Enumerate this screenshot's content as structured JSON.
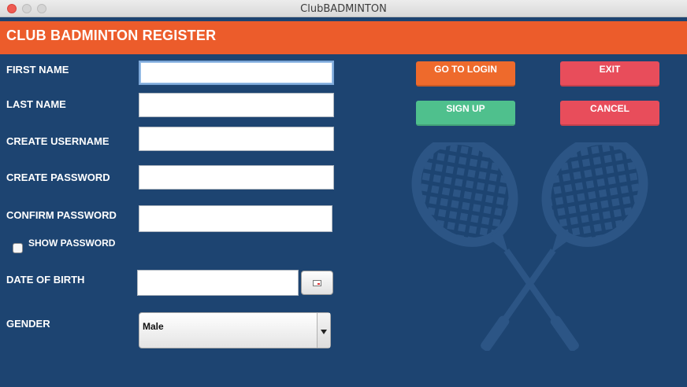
{
  "window": {
    "title": "ClubBADMINTON"
  },
  "header": {
    "title": "CLUB BADMINTON REGISTER"
  },
  "form": {
    "first_name_label": "FIRST NAME",
    "last_name_label": "LAST NAME",
    "username_label": "CREATE USERNAME",
    "password_label": "CREATE PASSWORD",
    "confirm_password_label": "CONFIRM PASSWORD",
    "show_password_label": "SHOW PASSWORD",
    "dob_label": "DATE OF BIRTH",
    "gender_label": "GENDER",
    "first_name_value": "",
    "last_name_value": "",
    "username_value": "",
    "password_value": "",
    "confirm_password_value": "",
    "dob_value": "",
    "gender_value": "Male"
  },
  "buttons": {
    "go_to_login": "GO TO LOGIN",
    "exit": "EXIT",
    "sign_up": "SIGN UP",
    "cancel": "CANCEL"
  },
  "colors": {
    "background": "#1d4471",
    "header": "#ec5c2b",
    "orange_button": "#ee6a2c",
    "red_button": "#e84d5b",
    "green_button": "#4fc08d"
  },
  "icons": {
    "calendar": "calendar-icon",
    "dropdown": "chevron-down-icon",
    "decoration": "crossed-badminton-rackets"
  }
}
